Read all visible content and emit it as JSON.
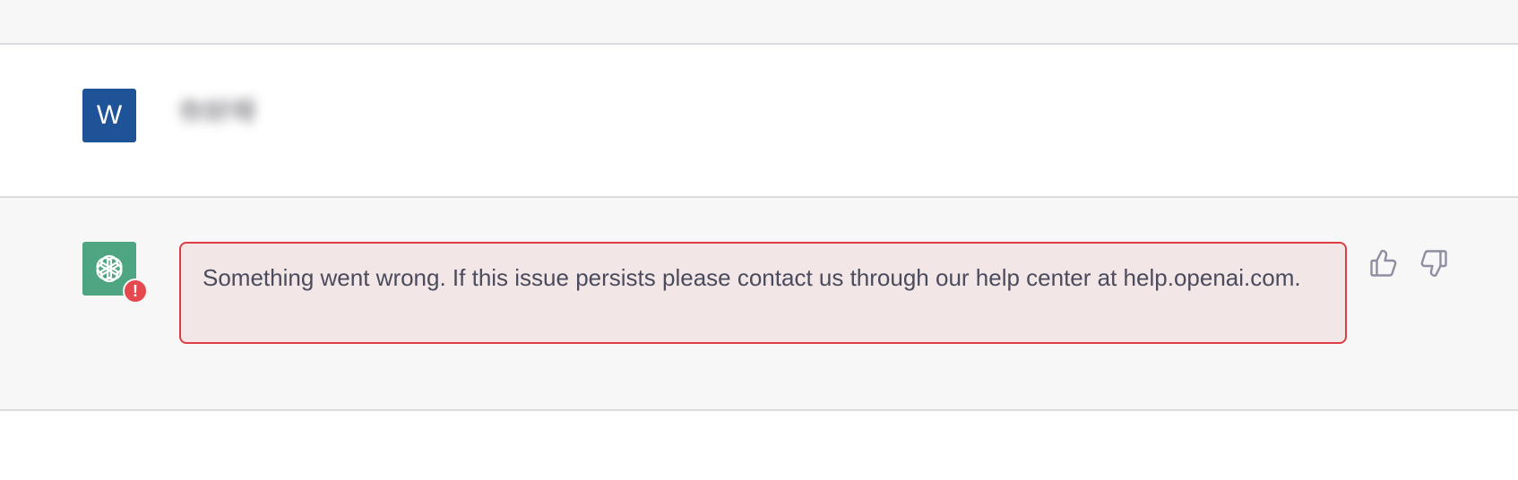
{
  "user": {
    "avatar_initial": "W",
    "avatar_color": "#1f5398",
    "message": "你好呀"
  },
  "assistant": {
    "avatar_color": "#4ea582",
    "avatar_icon": "openai-logo-icon",
    "error_badge": "!",
    "error_message": "Something went wrong. If this issue persists please contact us through our help center at help.openai.com.",
    "error_border_color": "#dc3d44",
    "error_bg_color": "#f2e6e7"
  },
  "feedback": {
    "thumbs_up_icon": "thumbs-up-icon",
    "thumbs_down_icon": "thumbs-down-icon"
  }
}
